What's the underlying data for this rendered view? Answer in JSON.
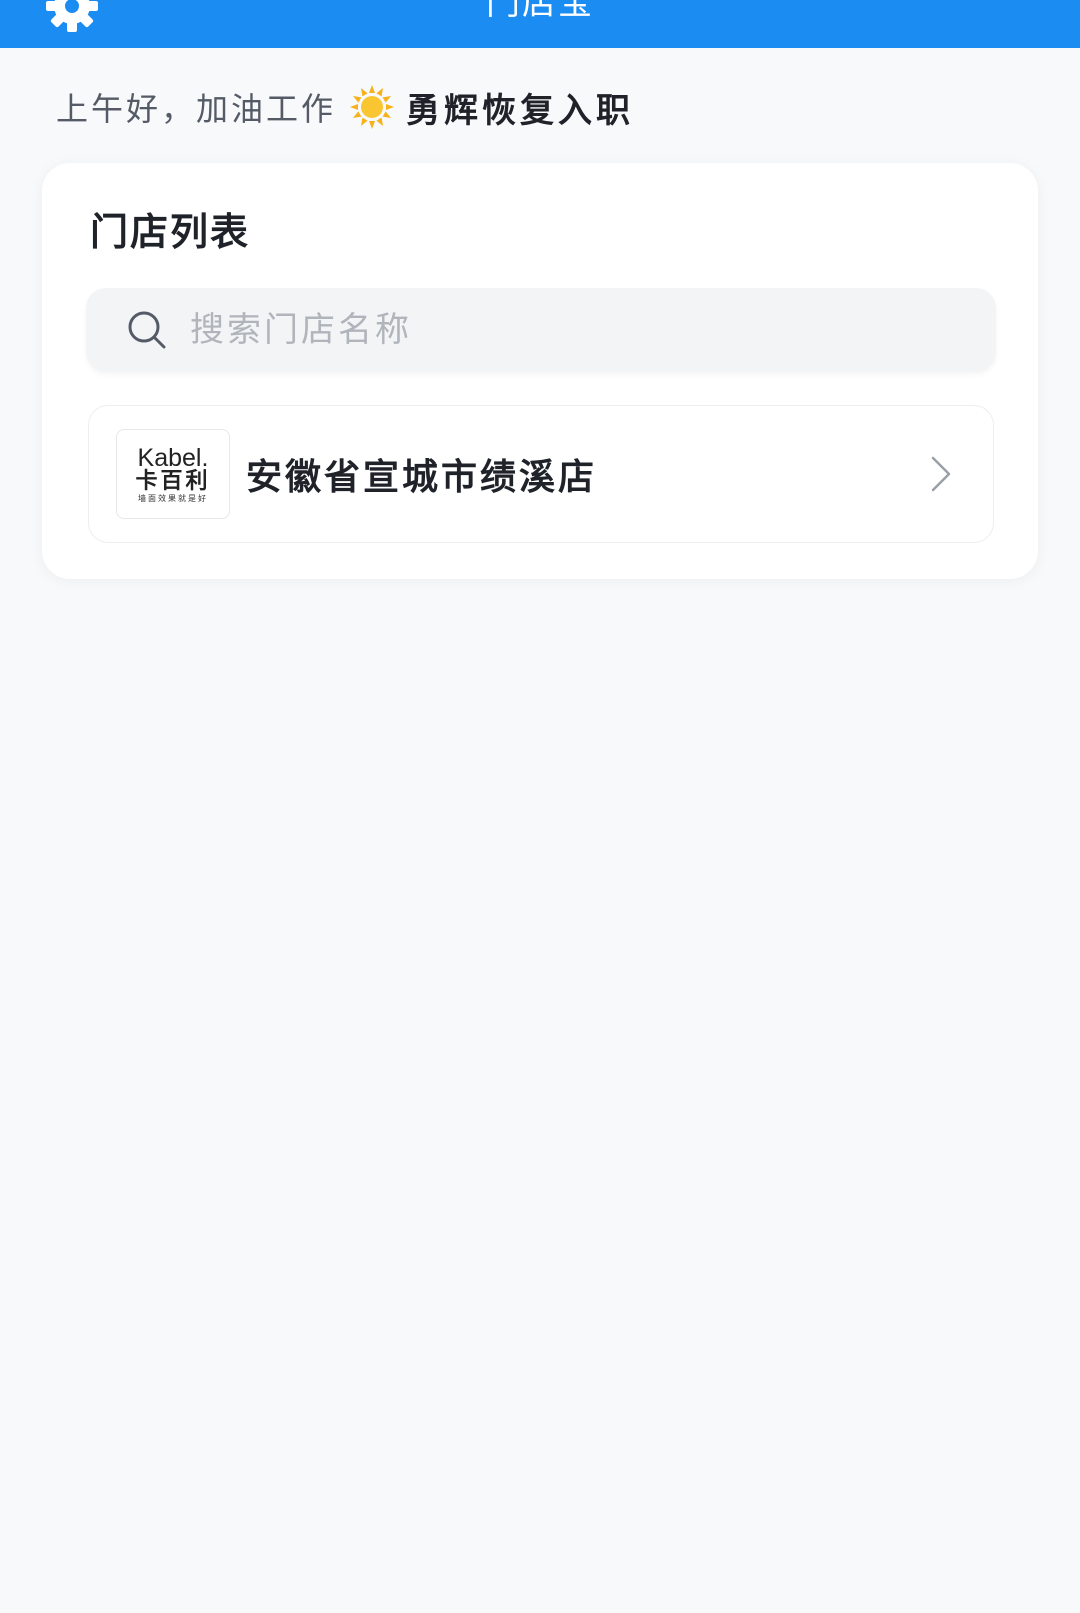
{
  "header": {
    "title": "门店宝",
    "settings_icon": "gear-icon",
    "background": "#1b8cf2"
  },
  "greeting": {
    "text": "上午好，加油工作",
    "icon": "sun-icon",
    "user_name": "勇辉恢复入职"
  },
  "store_list": {
    "title": "门店列表",
    "search": {
      "placeholder": "搜索门店名称",
      "value": ""
    },
    "items": [
      {
        "logo": {
          "brand_en": "Kabel.",
          "brand_cn": "卡百利",
          "slogan": "墙面效果就是好"
        },
        "name": "安徽省宣城市绩溪店"
      }
    ]
  }
}
